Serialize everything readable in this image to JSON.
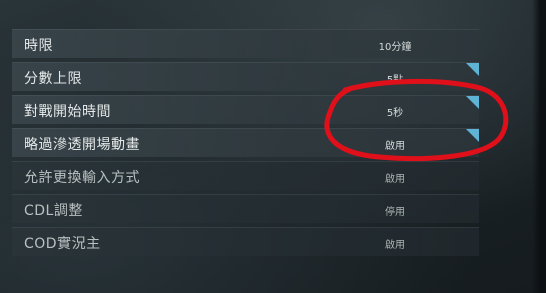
{
  "settings": [
    {
      "label": "時限",
      "value": "10分鐘",
      "highlighted": false,
      "dim": false
    },
    {
      "label": "分數上限",
      "value": "5點",
      "highlighted": true,
      "dim": false
    },
    {
      "label": "對戰開始時間",
      "value": "5秒",
      "highlighted": true,
      "dim": false
    },
    {
      "label": "略過滲透開場動畫",
      "value": "啟用",
      "highlighted": true,
      "dim": false
    },
    {
      "label": "允許更換輸入方式",
      "value": "啟用",
      "highlighted": false,
      "dim": true
    },
    {
      "label": "CDL調整",
      "value": "停用",
      "highlighted": false,
      "dim": true
    },
    {
      "label": "COD實況主",
      "value": "啟用",
      "highlighted": false,
      "dim": true
    }
  ],
  "colors": {
    "corner_marker": "#5fb4d6",
    "annotation_stroke": "#e0101a"
  },
  "icons": {
    "corner_marker": "modified-setting-indicator"
  }
}
